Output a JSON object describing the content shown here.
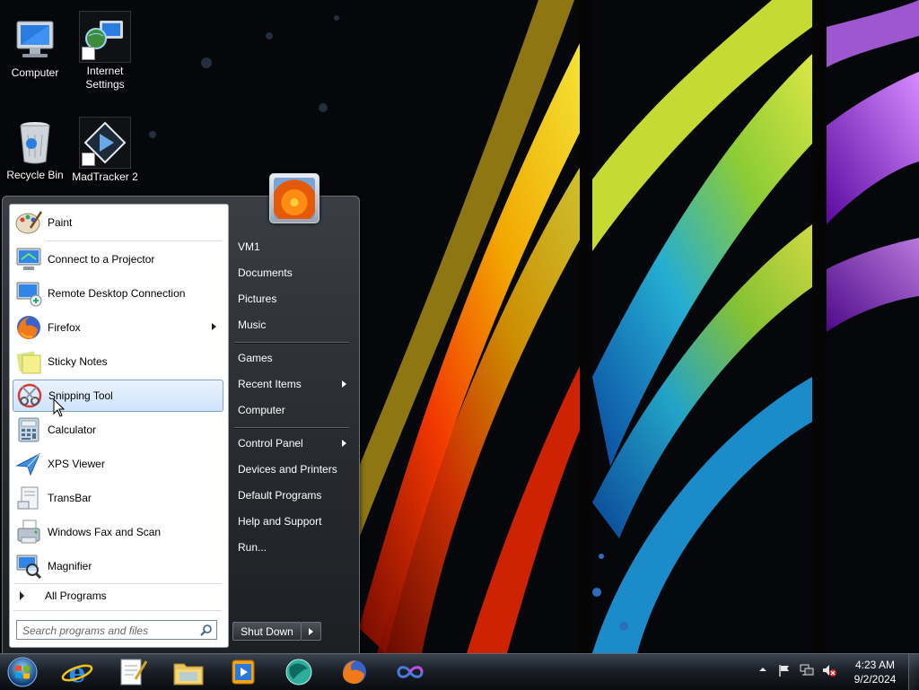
{
  "desktop": {
    "icons": [
      {
        "label": "Computer"
      },
      {
        "label": "Internet\nSettings",
        "line1": "Internet",
        "line2": "Settings"
      },
      {
        "label": "Recycle Bin"
      },
      {
        "label": "MadTracker 2"
      }
    ]
  },
  "start_menu": {
    "programs": [
      {
        "label": "Paint",
        "icon": "paint-icon"
      },
      {
        "label": "Connect to a Projector",
        "icon": "projector-icon"
      },
      {
        "label": "Remote Desktop Connection",
        "icon": "remote-desktop-icon"
      },
      {
        "label": "Firefox",
        "icon": "firefox-icon",
        "has_submenu": true
      },
      {
        "label": "Sticky Notes",
        "icon": "sticky-notes-icon"
      },
      {
        "label": "Snipping Tool",
        "icon": "scissors-icon",
        "highlighted": true
      },
      {
        "label": "Calculator",
        "icon": "calculator-icon"
      },
      {
        "label": "XPS Viewer",
        "icon": "xps-viewer-icon"
      },
      {
        "label": "TransBar",
        "icon": "transbar-icon"
      },
      {
        "label": "Windows Fax and Scan",
        "icon": "fax-icon"
      },
      {
        "label": "Magnifier",
        "icon": "magnifier-icon"
      }
    ],
    "all_programs_label": "All Programs",
    "search_placeholder": "Search programs and files",
    "right_items": [
      {
        "label": "VM1"
      },
      {
        "label": "Documents"
      },
      {
        "label": "Pictures"
      },
      {
        "label": "Music"
      },
      {
        "label": "Games"
      },
      {
        "label": "Recent Items",
        "has_submenu": true
      },
      {
        "label": "Computer"
      },
      {
        "label": "Control Panel",
        "has_submenu": true
      },
      {
        "label": "Devices and Printers"
      },
      {
        "label": "Default Programs"
      },
      {
        "label": "Help and Support"
      },
      {
        "label": "Run..."
      }
    ],
    "shutdown_label": "Shut Down"
  },
  "taskbar": {
    "pinned": [
      "internet-explorer-icon",
      "notepad-icon",
      "file-explorer-icon",
      "media-player-icon",
      "globe-app-icon",
      "firefox-icon",
      "infinity-app-icon"
    ],
    "clock_time": "4:23 AM",
    "clock_date": "9/2/2024"
  }
}
